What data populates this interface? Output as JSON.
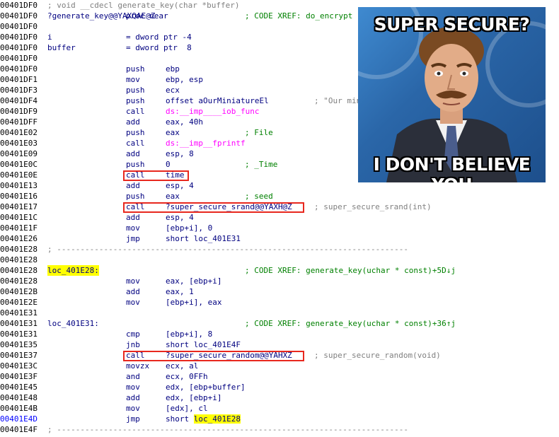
{
  "rows": [
    {
      "addr": "00401DF0",
      "cmt": "; void __cdecl generate_key(char *buffer)",
      "cmt_color": "gray"
    },
    {
      "addr": "00401DF0",
      "label": "?generate_key@@YAXQAE@Z",
      "mnem": "proc near",
      "cmt": "; CODE XREF: do_encrypt"
    },
    {
      "addr": "00401DF0"
    },
    {
      "addr": "00401DF0",
      "label": "i",
      "mnem": "= dword ptr -4"
    },
    {
      "addr": "00401DF0",
      "label": "buffer",
      "mnem": "= dword ptr  8"
    },
    {
      "addr": "00401DF0"
    },
    {
      "addr": "00401DF0",
      "mnem": "push",
      "op": "ebp"
    },
    {
      "addr": "00401DF1",
      "mnem": "mov",
      "op": "ebp, esp"
    },
    {
      "addr": "00401DF3",
      "mnem": "push",
      "op": "ecx"
    },
    {
      "addr": "00401DF4",
      "mnem": "push",
      "op": "offset aOurMiniatureEl",
      "rcmt": "; \"Our miniature"
    },
    {
      "addr": "00401DF9",
      "mnem": "call",
      "op": "ds:__imp____iob_func"
    },
    {
      "addr": "00401DFF",
      "mnem": "add",
      "op": "eax, 40h"
    },
    {
      "addr": "00401E02",
      "mnem": "push",
      "op": "eax",
      "cmt": "; File"
    },
    {
      "addr": "00401E03",
      "mnem": "call",
      "op": "ds:__imp__fprintf"
    },
    {
      "addr": "00401E09",
      "mnem": "add",
      "op": "esp, 8"
    },
    {
      "addr": "00401E0C",
      "mnem": "push",
      "op": "0",
      "cmt": "; _Time"
    },
    {
      "addr": "00401E0E",
      "mnem": "call",
      "op": "time"
    },
    {
      "addr": "00401E13",
      "mnem": "add",
      "op": "esp, 4"
    },
    {
      "addr": "00401E16",
      "mnem": "push",
      "op": "eax",
      "cmt": "; seed"
    },
    {
      "addr": "00401E17",
      "mnem": "call",
      "op": "?super_secure_srand@@YAXH@Z",
      "rcmt": "; super_secure_srand(int)"
    },
    {
      "addr": "00401E1C",
      "mnem": "add",
      "op": "esp, 4"
    },
    {
      "addr": "00401E1F",
      "mnem": "mov",
      "op": "[ebp+i], 0"
    },
    {
      "addr": "00401E26",
      "mnem": "jmp",
      "op": "short loc_401E31"
    },
    {
      "addr": "00401E28",
      "sep": "; ---------------------------------------------------------------------------"
    },
    {
      "addr": "00401E28"
    },
    {
      "addr": "00401E28",
      "label": "loc_401E28:",
      "cmt": "; CODE XREF: generate_key(uchar * const)+5D↓j"
    },
    {
      "addr": "00401E28",
      "mnem": "mov",
      "op": "eax, [ebp+i]"
    },
    {
      "addr": "00401E2B",
      "mnem": "add",
      "op": "eax, 1"
    },
    {
      "addr": "00401E2E",
      "mnem": "mov",
      "op": "[ebp+i], eax"
    },
    {
      "addr": "00401E31"
    },
    {
      "addr": "00401E31",
      "label": "loc_401E31:",
      "cmt": "; CODE XREF: generate_key(uchar * const)+36↑j"
    },
    {
      "addr": "00401E31",
      "mnem": "cmp",
      "op": "[ebp+i], 8"
    },
    {
      "addr": "00401E35",
      "mnem": "jnb",
      "op": "short loc_401E4F"
    },
    {
      "addr": "00401E37",
      "mnem": "call",
      "op": "?super_secure_random@@YAHXZ",
      "rcmt": "; super_secure_random(void)"
    },
    {
      "addr": "00401E3C",
      "mnem": "movzx",
      "op": "ecx, al"
    },
    {
      "addr": "00401E3F",
      "mnem": "and",
      "op": "ecx, 0FFh"
    },
    {
      "addr": "00401E45",
      "mnem": "mov",
      "op": "edx, [ebp+buffer]"
    },
    {
      "addr": "00401E48",
      "mnem": "add",
      "op": "edx, [ebp+i]"
    },
    {
      "addr": "00401E4B",
      "mnem": "mov",
      "op": "[edx], cl"
    },
    {
      "addr": "00401E4D",
      "mnem": "jmp",
      "op": "short loc_401E28"
    },
    {
      "addr": "00401E4F",
      "sep": "; ---------------------------------------------------------------------------"
    }
  ],
  "highlighted_labels": [
    "loc_401E28:",
    "loc_401E28"
  ],
  "boxed_rows": [
    16,
    19,
    33
  ],
  "meme": {
    "top_text": "SUPER SECURE?",
    "bottom_text": "I DON'T BELIEVE YOU"
  },
  "colors": {
    "box": "#e8281e",
    "highlight": "#ffff00",
    "code": "#000080",
    "comment": "#008000",
    "gray": "#808080"
  }
}
